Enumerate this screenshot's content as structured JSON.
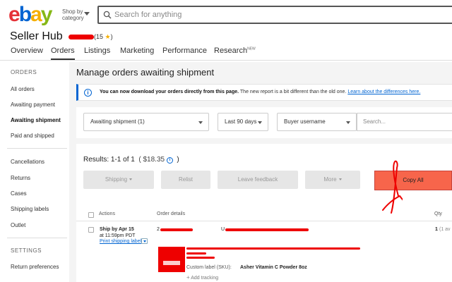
{
  "header": {
    "logo": {
      "e": "e",
      "b": "b",
      "a": "a",
      "y": "y"
    },
    "shop_by_category": "Shop by category",
    "search_placeholder": "Search for anything"
  },
  "hub": {
    "title": "Seller Hub",
    "feedback_score": "(15",
    "feedback_star": "★",
    "feedback_close": ")"
  },
  "nav": {
    "tabs": [
      {
        "label": "Overview"
      },
      {
        "label": "Orders",
        "active": true
      },
      {
        "label": "Listings"
      },
      {
        "label": "Marketing"
      },
      {
        "label": "Performance"
      },
      {
        "label": "Research",
        "sup": "NEW"
      }
    ]
  },
  "sidebar": {
    "orders_heading": "ORDERS",
    "items": [
      "All orders",
      "Awaiting payment",
      "Awaiting shipment",
      "Paid and shipped",
      "Cancellations",
      "Returns",
      "Cases",
      "Shipping labels",
      "Outlet"
    ],
    "active_item": "Awaiting shipment",
    "settings_heading": "SETTINGS",
    "settings_items": [
      "Return preferences"
    ]
  },
  "main": {
    "title": "Manage orders awaiting shipment",
    "notice": {
      "bold": "You can now download your orders directly from this page.",
      "text": " The new report is a bit different than the old one. ",
      "link": "Learn about the differences here."
    },
    "filters": {
      "status": "Awaiting shipment (1)",
      "period": "Last 90 days",
      "buyer": "Buyer username",
      "search_placeholder": "Search..."
    },
    "results": {
      "label": "Results: 1-1 of 1",
      "amount": "( $18.35",
      "info": "i",
      "close": ")"
    },
    "buttons": {
      "shipping": "Shipping",
      "relist": "Relist",
      "leave_feedback": "Leave feedback",
      "more": "More",
      "copy_all": "Copy All"
    },
    "table": {
      "headers": {
        "actions": "Actions",
        "order_details": "Order details",
        "qty": "Qty"
      },
      "row": {
        "ship_by": "Ship by Apr 15",
        "ship_time": "at 11:59pm PDT",
        "print_label": "Print shipping label",
        "order_prefix": "2",
        "buyer_prefix": "U",
        "qty": "1",
        "qty_suffix": "(1 av",
        "custom_label": "Custom label (SKU):",
        "sku": "Asher Vitamin C Powder 8oz",
        "add_tracking": "Add tracking"
      }
    }
  },
  "colors": {
    "accent_blue": "#0064d2",
    "copy_all": "#f7654b",
    "annotation_red": "#e00000"
  }
}
